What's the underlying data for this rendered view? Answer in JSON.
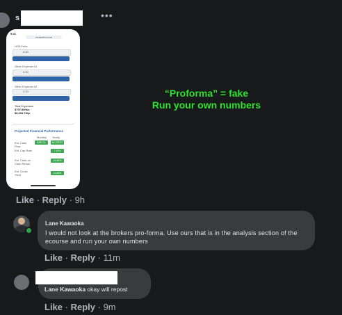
{
  "comment1": {
    "name_prefix": "s",
    "more_icon": "more-horizontal-icon",
    "attachment": {
      "caption_line1": "“Proforma” = fake",
      "caption_line2": "Run your own numbers",
      "phone": {
        "url": "redacted.com",
        "fields": [
          {
            "label": "HOA Fees",
            "value": "0.00"
          },
          {
            "label": "Other Expense #1",
            "value": "0.00"
          },
          {
            "label": "Other Expense #2",
            "value": "0.00"
          }
        ],
        "total_label": "Total Expenses",
        "total_monthly": "$707.89/mo",
        "total_yearly": "$8,494.78/yr",
        "section_title": "Projected Financial Performance",
        "col_monthly": "Monthly",
        "col_yearly": "Yearly",
        "rows": [
          {
            "label": "Est. Cash Flow",
            "monthly": "$392.11",
            "yearly": "$4,705.31"
          },
          {
            "label": "Est. Cap Rate",
            "monthly": "",
            "yearly": "7.19%"
          },
          {
            "label": "Est. Cash on Cash Return",
            "monthly": "",
            "yearly": "19.48%"
          },
          {
            "label": "Est. Gross Yield",
            "monthly": "",
            "yearly": "11.66%"
          }
        ]
      }
    },
    "actions": {
      "like": "Like",
      "reply": "Reply",
      "time": "9h"
    }
  },
  "reply1": {
    "author": "Lane Kawaoka",
    "text": "I would not look at the brokers pro-forma. Use ours that is in the analysis section of the ecourse and run your own numbers",
    "actions": {
      "like": "Like",
      "reply": "Reply",
      "time": "11m"
    }
  },
  "reply2": {
    "mention": "Lane Kawaoka",
    "text": " okay will repost",
    "actions": {
      "like": "Like",
      "reply": "Reply",
      "time": "9m"
    }
  },
  "colors": {
    "background": "#18191a",
    "bubble": "#3a3b3c",
    "caption_green": "#2fe22f",
    "online_dot": "#31a24c"
  }
}
